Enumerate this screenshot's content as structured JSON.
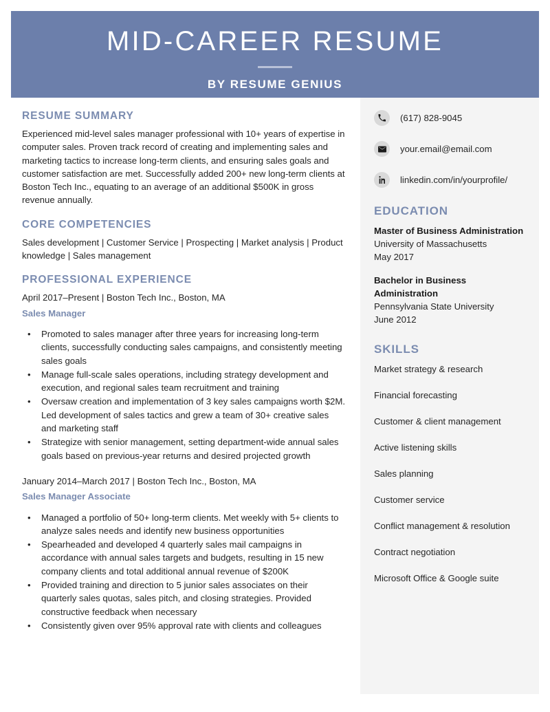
{
  "header": {
    "title": "MID-CAREER RESUME",
    "subtitle": "BY RESUME GENIUS"
  },
  "main": {
    "summary": {
      "heading": "RESUME SUMMARY",
      "text": "Experienced mid-level sales manager professional with 10+ years of expertise in computer sales. Proven track record of creating and implementing sales and marketing tactics to increase long-term clients, and ensuring sales goals and customer satisfaction are met. Successfully added 200+ new long-term clients at Boston Tech Inc., equating to an average of an additional $500K in gross revenue annually."
    },
    "competencies": {
      "heading": "CORE COMPETENCIES",
      "text": "Sales development | Customer Service | Prospecting | Market analysis | Product knowledge | Sales management"
    },
    "experience": {
      "heading": "PROFESSIONAL EXPERIENCE",
      "jobs": [
        {
          "meta": "April 2017–Present | Boston Tech Inc., Boston, MA",
          "title": "Sales Manager",
          "bullets": [
            "Promoted to sales manager after three years for increasing long-term clients, successfully conducting sales campaigns, and consistently meeting sales goals",
            "Manage full-scale sales operations, including strategy development and execution, and regional sales team recruitment and training",
            "Oversaw creation and implementation of 3 key sales campaigns worth $2M. Led development of sales tactics and grew a team of 30+ creative sales and marketing staff",
            "Strategize with senior management, setting department-wide annual sales goals based on previous-year returns and desired projected growth"
          ]
        },
        {
          "meta": "January 2014–March 2017 | Boston Tech Inc., Boston, MA",
          "title": "Sales Manager Associate",
          "bullets": [
            "Managed a portfolio of 50+ long-term clients. Met weekly with 5+ clients to analyze sales needs and identify new business opportunities",
            "Spearheaded and developed 4 quarterly sales mail campaigns in accordance with annual sales targets and budgets, resulting in 15 new company clients and total additional annual revenue of $200K",
            "Provided training and direction to 5 junior sales associates on their quarterly sales quotas, sales pitch, and closing strategies. Provided constructive feedback when necessary",
            "Consistently given over 95% approval rate with clients and colleagues"
          ]
        }
      ]
    }
  },
  "sidebar": {
    "contacts": [
      {
        "icon": "phone-icon",
        "value": "(617) 828-9045"
      },
      {
        "icon": "email-icon",
        "value": "your.email@email.com"
      },
      {
        "icon": "linkedin-icon",
        "value": "linkedin.com/in/yourprofile/"
      }
    ],
    "education": {
      "heading": "EDUCATION",
      "entries": [
        {
          "degree": "Master of Business Administration",
          "school": "University of Massachusetts",
          "date": "May 2017"
        },
        {
          "degree": "Bachelor in Business Administration",
          "school": "Pennsylvania State University",
          "date": "June 2012"
        }
      ]
    },
    "skills": {
      "heading": "SKILLS",
      "items": [
        "Market strategy & research",
        "Financial forecasting",
        "Customer & client management",
        "Active listening skills",
        "Sales planning",
        "Customer service",
        "Conflict management & resolution",
        "Contract negotiation",
        "Microsoft Office & Google suite"
      ]
    }
  },
  "colors": {
    "header_blue": "#6c7fab",
    "heading_blue": "#7b8cb0",
    "sidebar_bg": "#f4f4f4",
    "body_text": "#262626"
  }
}
